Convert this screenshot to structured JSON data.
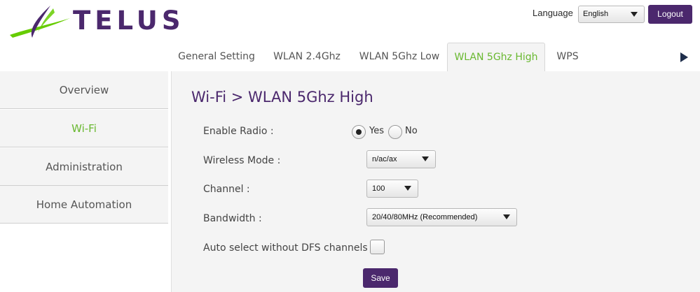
{
  "brand": {
    "name": "TELUS",
    "color": "#4b286d",
    "accent": "#66cc00"
  },
  "header": {
    "language_label": "Language",
    "language_selected": "English",
    "logout_label": "Logout"
  },
  "tabs": [
    {
      "label": "General Setting"
    },
    {
      "label": "WLAN 2.4Ghz"
    },
    {
      "label": "WLAN 5Ghz Low"
    },
    {
      "label": "WLAN 5Ghz High",
      "active": true
    },
    {
      "label": "WPS"
    }
  ],
  "sidebar": {
    "items": [
      {
        "label": "Overview"
      },
      {
        "label": "Wi-Fi",
        "active": true
      },
      {
        "label": "Administration"
      },
      {
        "label": "Home Automation"
      }
    ]
  },
  "main": {
    "title": "Wi-Fi > WLAN 5Ghz High",
    "enable_radio": {
      "label": "Enable Radio :",
      "yes": "Yes",
      "no": "No",
      "selected": "Yes"
    },
    "wireless_mode": {
      "label": "Wireless Mode :",
      "value": "n/ac/ax"
    },
    "channel": {
      "label": "Channel :",
      "value": "100"
    },
    "bandwidth": {
      "label": "Bandwidth :",
      "value": "20/40/80MHz (Recommended)"
    },
    "auto_select": {
      "label": "Auto select without DFS channels :",
      "checked": false
    },
    "save_label": "Save"
  },
  "icons": {
    "logo": "telus-swoosh-icon",
    "dropdown": "chevron-down-icon",
    "next": "arrow-right-icon"
  }
}
